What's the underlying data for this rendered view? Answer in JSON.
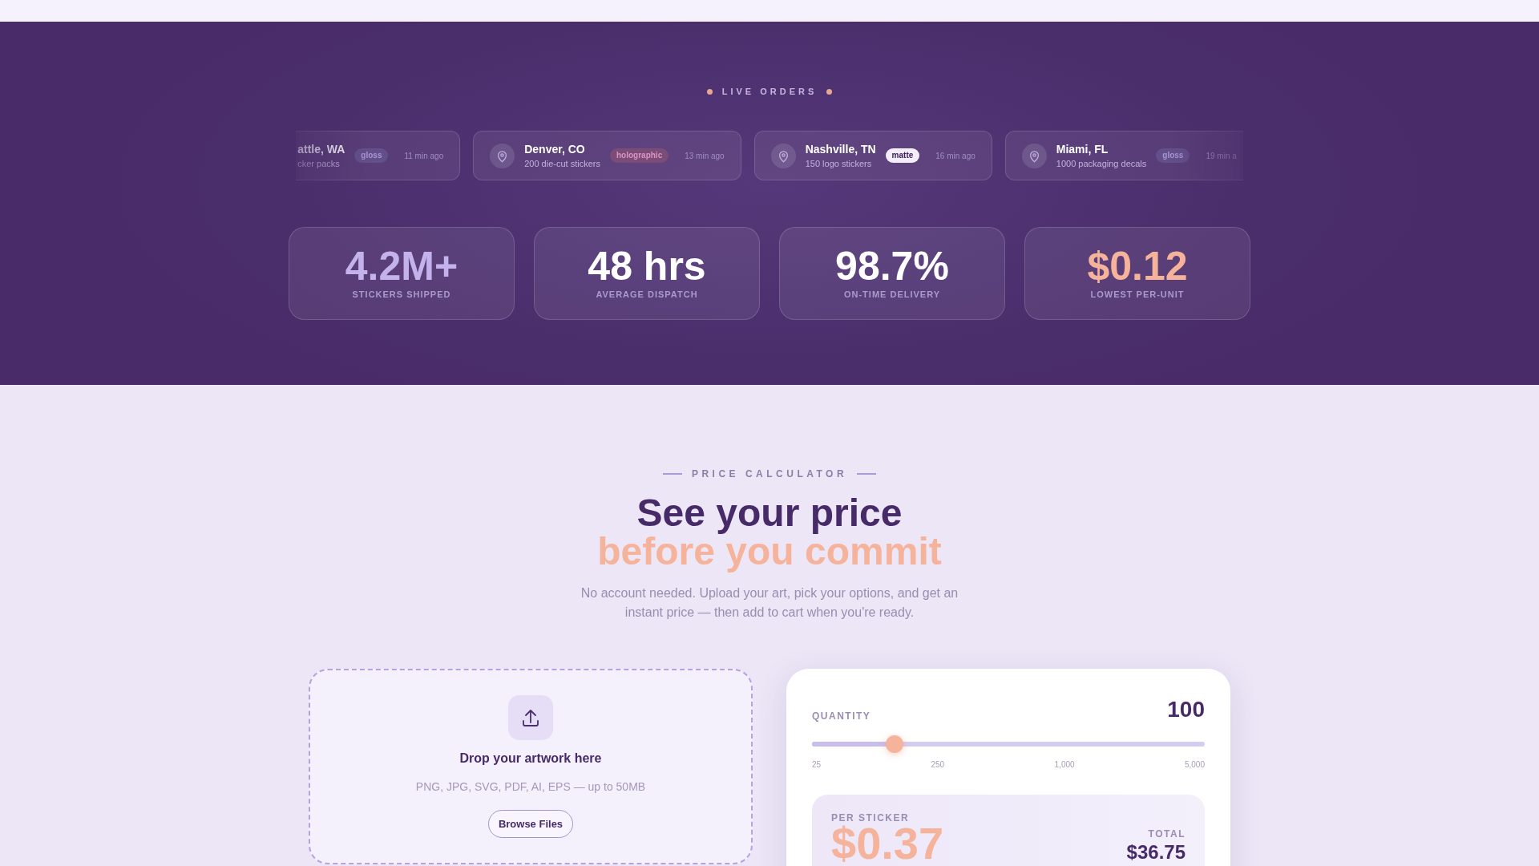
{
  "live_orders": {
    "title": "LIVE ORDERS",
    "orders": [
      {
        "kind": "cut-start",
        "city": "attle, WA",
        "items": "cker packs",
        "badge": {
          "text": "gloss",
          "kind": "gloss"
        },
        "time": "11 min ago"
      },
      {
        "kind": "whole",
        "city": "Denver, CO",
        "items": "200 die-cut stickers",
        "badge": {
          "text": "holographic",
          "kind": "holographic"
        },
        "time": "13 min ago"
      },
      {
        "kind": "whole",
        "city": "Nashville, TN",
        "items": "150 logo stickers",
        "badge": {
          "text": "matte",
          "kind": "matte"
        },
        "time": "16 min ago"
      },
      {
        "kind": "cut-end",
        "city": "Miami, FL",
        "items": "1000 packaging decals",
        "badge": {
          "text": "gloss",
          "kind": "gloss"
        },
        "time": "19 min a"
      }
    ]
  },
  "stats": [
    {
      "value": "4.2M+",
      "label": "STICKERS SHIPPED",
      "color": "#c4b2ec"
    },
    {
      "value": "48 hrs",
      "label": "AVERAGE DISPATCH",
      "color": "#ffffff"
    },
    {
      "value": "98.7%",
      "label": "ON-TIME DELIVERY",
      "color": "#ffffff"
    },
    {
      "value": "$0.12",
      "label": "LOWEST PER-UNIT",
      "color": "#f6b39b"
    }
  ],
  "calculator": {
    "eyebrow": "PRICE CALCULATOR",
    "title": "See your price",
    "title_accent": "before you commit",
    "intro": "No account needed. Upload your art, pick your options, and get an instant price — then add to cart when you're ready.",
    "upload": {
      "title": "Drop your artwork here",
      "formats": "PNG, JPG, SVG, PDF, AI, EPS — up to 50MB",
      "button": "Browse Files"
    },
    "quantity": {
      "label": "QUANTITY",
      "value": "100",
      "level": 0.21,
      "ticks": [
        "25",
        "250",
        "1,000",
        "5,000"
      ]
    },
    "summary": {
      "per_label": "PER STICKER",
      "per_value": "$0.37",
      "total_label": "TOTAL",
      "total_value": "$36.75"
    }
  }
}
